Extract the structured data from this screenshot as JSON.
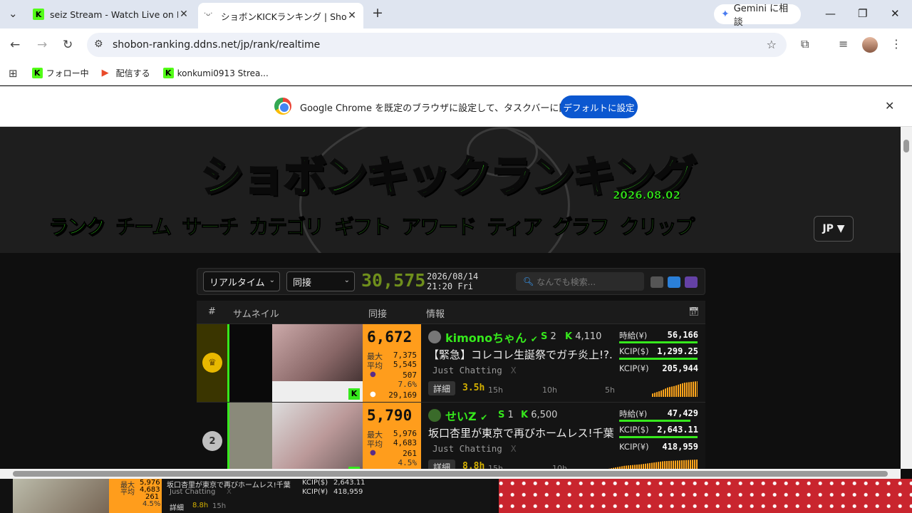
{
  "browser": {
    "tabs": [
      {
        "title": "seiz Stream - Watch Live on Kick",
        "active": false
      },
      {
        "title": "ショボンKICKランキング | Shobon Kick",
        "active": true
      }
    ],
    "new_tab": "+",
    "gemini_label": "Gemini に相談",
    "url": "shobon-ranking.ddns.net/jp/rank/realtime",
    "bookmarks": [
      "フォロー中",
      "配信する",
      "konkumi0913 Strea..."
    ],
    "infobar": {
      "message": "Google Chrome を既定のブラウザに設定して、タスクバーに固定する",
      "button": "デフォルトに設定"
    }
  },
  "site": {
    "logo_text": "ショボンキックランキング",
    "logo_date": "2026.08.02",
    "nav": [
      "ランク",
      "チーム",
      "サーチ",
      "カテゴリ",
      "ギフト",
      "アワード",
      "ティア",
      "グラフ",
      "クリップ"
    ],
    "lang": "JP ▼",
    "controls": {
      "mode": "リアルタイム",
      "metric": "同接",
      "total_viewers": "30,575",
      "date": "2026/08/14",
      "time": "21:20 Fri",
      "search_placeholder": "なんでも検索..."
    },
    "table_headers": {
      "rank": "#",
      "thumb": "サムネイル",
      "viewers": "同接",
      "info": "情報"
    },
    "rows": [
      {
        "rank": "1",
        "viewers": "6,672",
        "max_label": "最大",
        "max": "7,375",
        "avg_label": "平均",
        "avg": "5,545",
        "subs": "507",
        "pct": "7.6%",
        "extra": "29,169",
        "name": "kimonoちゃん",
        "s_count": "2",
        "k_count": "4,110",
        "title": "【緊急】コレコレ生誕祭でガチ炎上!?...",
        "category": "Just Chatting",
        "category_x": "X",
        "detail": "詳細",
        "duration": "3.5h",
        "timeline": [
          "15h",
          "10h",
          "5h"
        ],
        "hourly_label": "時給(¥)",
        "hourly": "56,166",
        "kcip_usd_label": "KCIP($)",
        "kcip_usd": "1,299.25",
        "kcip_jpy_label": "KCIP(¥)",
        "kcip_jpy": "205,944"
      },
      {
        "rank": "2",
        "viewers": "5,790",
        "max_label": "最大",
        "max": "5,976",
        "avg_label": "平均",
        "avg": "4,683",
        "subs": "261",
        "pct": "4.5%",
        "name": "せいZ",
        "s_count": "1",
        "k_count": "6,500",
        "title": "坂口杏里が東京で再びホームレス!千葉",
        "category": "Just Chatting",
        "category_x": "X",
        "detail": "詳細",
        "duration": "8.8h",
        "timeline": [
          "15h",
          "10h"
        ],
        "hourly_label": "時給(¥)",
        "hourly": "47,429",
        "kcip_usd_label": "KCIP($)",
        "kcip_usd": "2,643.11",
        "kcip_jpy_label": "KCIP(¥)",
        "kcip_jpy": "418,959"
      }
    ]
  },
  "pip": {
    "max": "5,976",
    "avg": "4,683",
    "subs": "261",
    "pct": "4.5%",
    "max_label": "最大",
    "avg_label": "平均",
    "title": "坂口杏里が東京で再びホームレス!千葉",
    "category": "Just Chatting",
    "category_x": "X",
    "kcip_usd_label": "KCIP($)",
    "kcip_usd": "2,643.11",
    "kcip_jpy_label": "KCIP(¥)",
    "kcip_jpy": "418,959",
    "detail": "詳細",
    "duration": "8.8h",
    "timeline": "15h"
  },
  "colors": {
    "accent": "#36e81c",
    "orange": "#ff9d1c",
    "chrome_blue": "#0b57d0"
  }
}
